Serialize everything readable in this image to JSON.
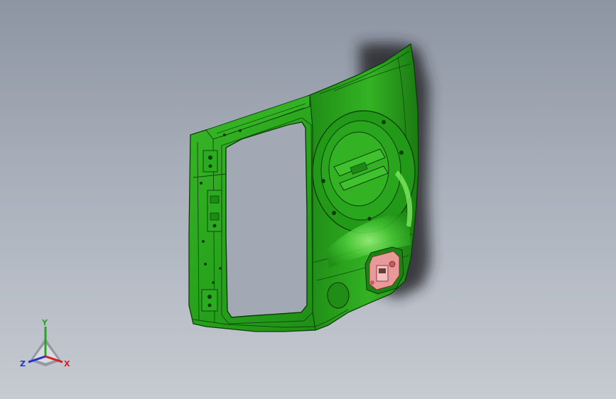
{
  "viewport": {
    "background_top": "#8d95a2",
    "background_bottom": "#c6cad1"
  },
  "model": {
    "part": "door-inner-panel",
    "body_color": "#2aa61e",
    "edge_color": "#0c3d08",
    "highlight_color": "#6fe05a",
    "shadow_color": "#2b2b30",
    "component_color": "#e89a9a"
  },
  "triad": {
    "x_label": "X",
    "y_label": "Y",
    "z_label": "Z",
    "x_color": "#d61f1f",
    "y_color": "#2ea02e",
    "z_color": "#2233cc"
  }
}
